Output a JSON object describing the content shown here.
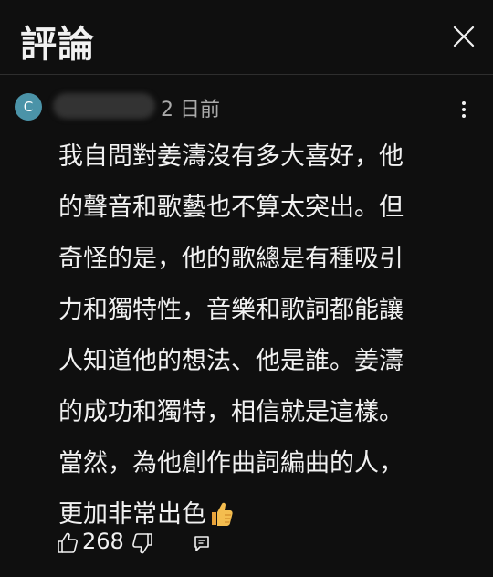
{
  "header": {
    "title": "評論",
    "close_icon": "close-icon"
  },
  "comment": {
    "avatar_letter": "C",
    "avatar_color": "#4b93a8",
    "timestamp": "2 日前",
    "more_icon": "more-vert-icon",
    "lines": [
      "我自問對姜濤沒有多大喜好，他",
      "的聲音和歌藝也不算太突出。但",
      "奇怪的是，他的歌總是有種吸引",
      "力和獨特性，音樂和歌詞都能讓",
      "人知道他的想法、他是誰。姜濤",
      "的成功和獨特，相信就是這樣。",
      "當然，為他創作曲詞編曲的人，",
      "更加非常出色"
    ],
    "trailing_emoji": "thumbs-up-emoji",
    "like_count": "268",
    "like_icon": "thumbs-up-icon",
    "dislike_icon": "thumbs-down-icon",
    "reply_icon": "reply-icon"
  },
  "colors": {
    "background": "#0f0f0f",
    "text": "#f1f1f1",
    "secondary_text": "#aaaaaa",
    "divider": "#2e2e2e"
  }
}
